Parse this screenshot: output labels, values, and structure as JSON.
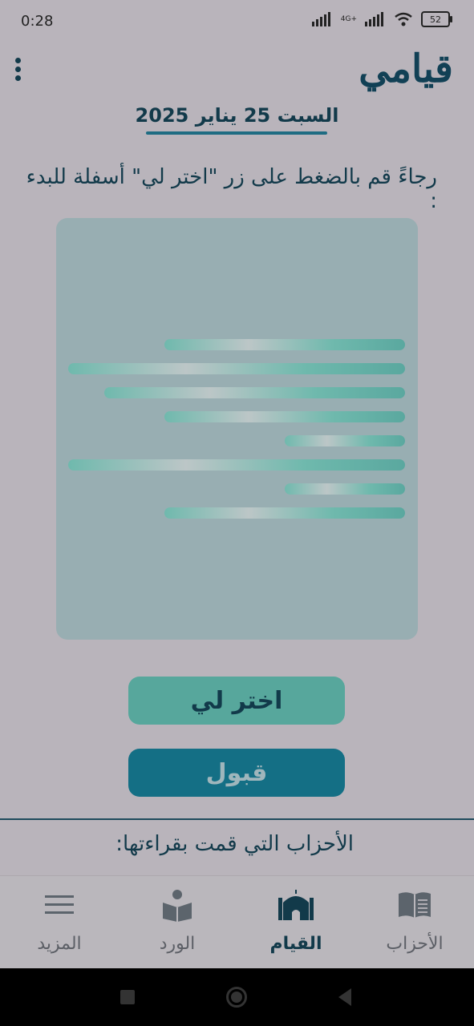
{
  "status": {
    "time": "0:28",
    "network": "4G+",
    "battery": "52"
  },
  "header": {
    "app_title": "قيامي",
    "date": "السبت 25 يناير 2025"
  },
  "instruction": "رجاءً قم بالضغط على زر \"اختر لي\" أسفلة للبدء :",
  "buttons": {
    "choose": "اختر لي",
    "accept": "قبول"
  },
  "read_section": {
    "title": "الأحزاب التي قمت بقراءتها:"
  },
  "nav": {
    "items": [
      {
        "label": "الأحزاب",
        "icon": "book-icon"
      },
      {
        "label": "القيام",
        "icon": "mosque-icon",
        "active": true
      },
      {
        "label": "الورد",
        "icon": "reading-person-icon"
      },
      {
        "label": "المزيد",
        "icon": "menu-icon"
      }
    ]
  },
  "colors": {
    "accent": "#146f85",
    "secondary": "#57a79c",
    "text": "#123a4a"
  }
}
